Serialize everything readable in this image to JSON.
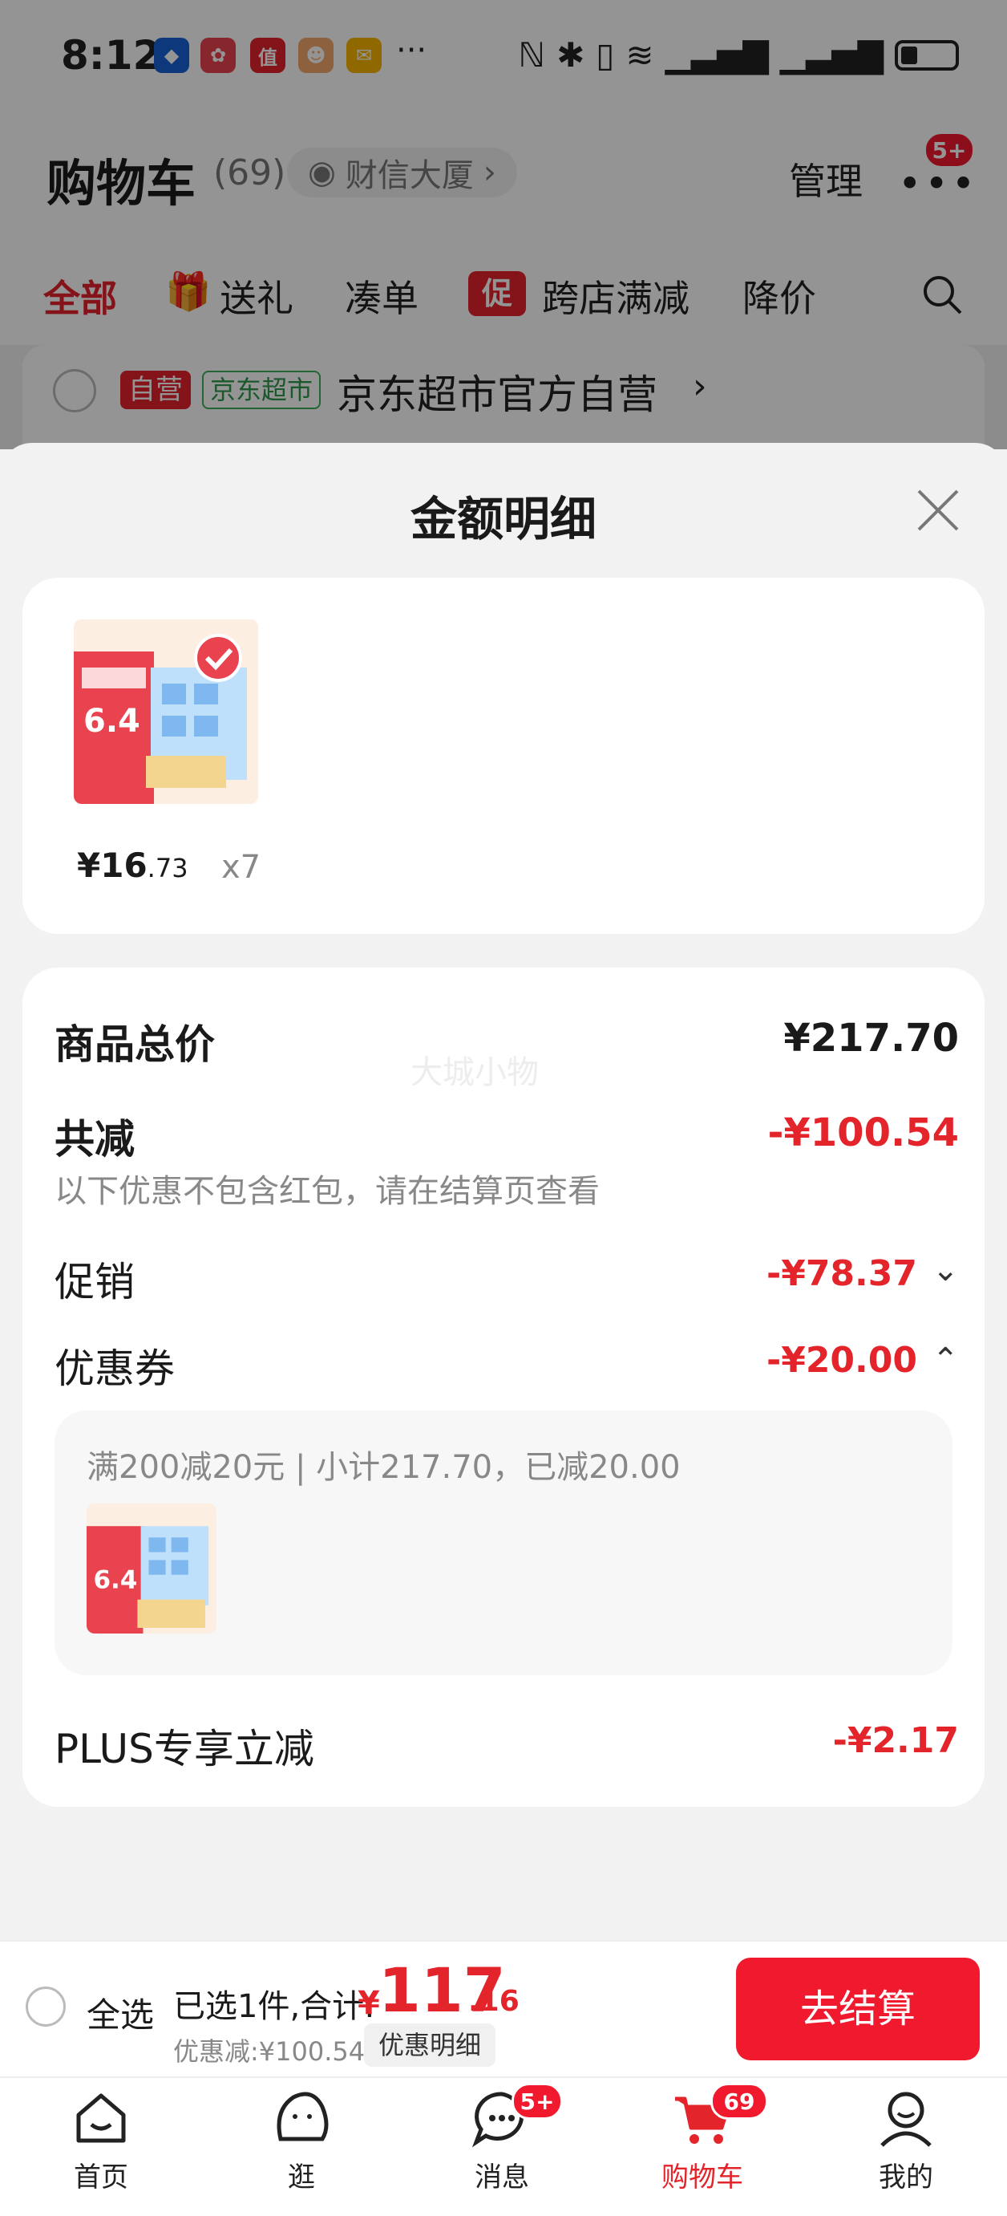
{
  "status_bar": {
    "time": "8:12",
    "more": "···"
  },
  "cart_header": {
    "title": "购物车",
    "count": "(69)",
    "location": "财信大厦",
    "manage": "管理",
    "more_badge": "5+"
  },
  "filters": [
    "全部",
    "送礼",
    "凑单",
    "跨店满减",
    "降价"
  ],
  "promo_tag": "促",
  "store": {
    "tag1": "自营",
    "tag2": "京东超市",
    "name": "京东超市官方自营"
  },
  "sheet": {
    "title": "金额明细",
    "item": {
      "price_int": "¥16",
      "price_dec": ".73",
      "qty": "x7"
    },
    "total_label": "商品总价",
    "total_value": "¥217.70",
    "reduce_label": "共减",
    "reduce_value": "-¥100.54",
    "reduce_note": "以下优惠不包含红包，请在结算页查看",
    "promo_label": "促销",
    "promo_value": "-¥78.37",
    "coupon_label": "优惠券",
    "coupon_value": "-¥20.00",
    "coupon_detail": "满200减20元 | 小计217.70，已减20.00",
    "plus_label": "PLUS专享立减",
    "plus_value": "-¥2.17",
    "watermark": "大城小物"
  },
  "checkout": {
    "select_all": "全选",
    "summary": "已选1件,合计:",
    "currency": "¥",
    "total_int": "117",
    "total_dec": ".16",
    "discount": "优惠减:¥100.54",
    "detail_btn": "优惠明细",
    "checkout_btn": "去结算"
  },
  "tabs": [
    {
      "label": "首页"
    },
    {
      "label": "逛"
    },
    {
      "label": "消息",
      "badge": "5+"
    },
    {
      "label": "购物车",
      "badge": "69"
    },
    {
      "label": "我的"
    }
  ],
  "colors": {
    "accent": "#e3242b",
    "button": "#f0192d"
  }
}
